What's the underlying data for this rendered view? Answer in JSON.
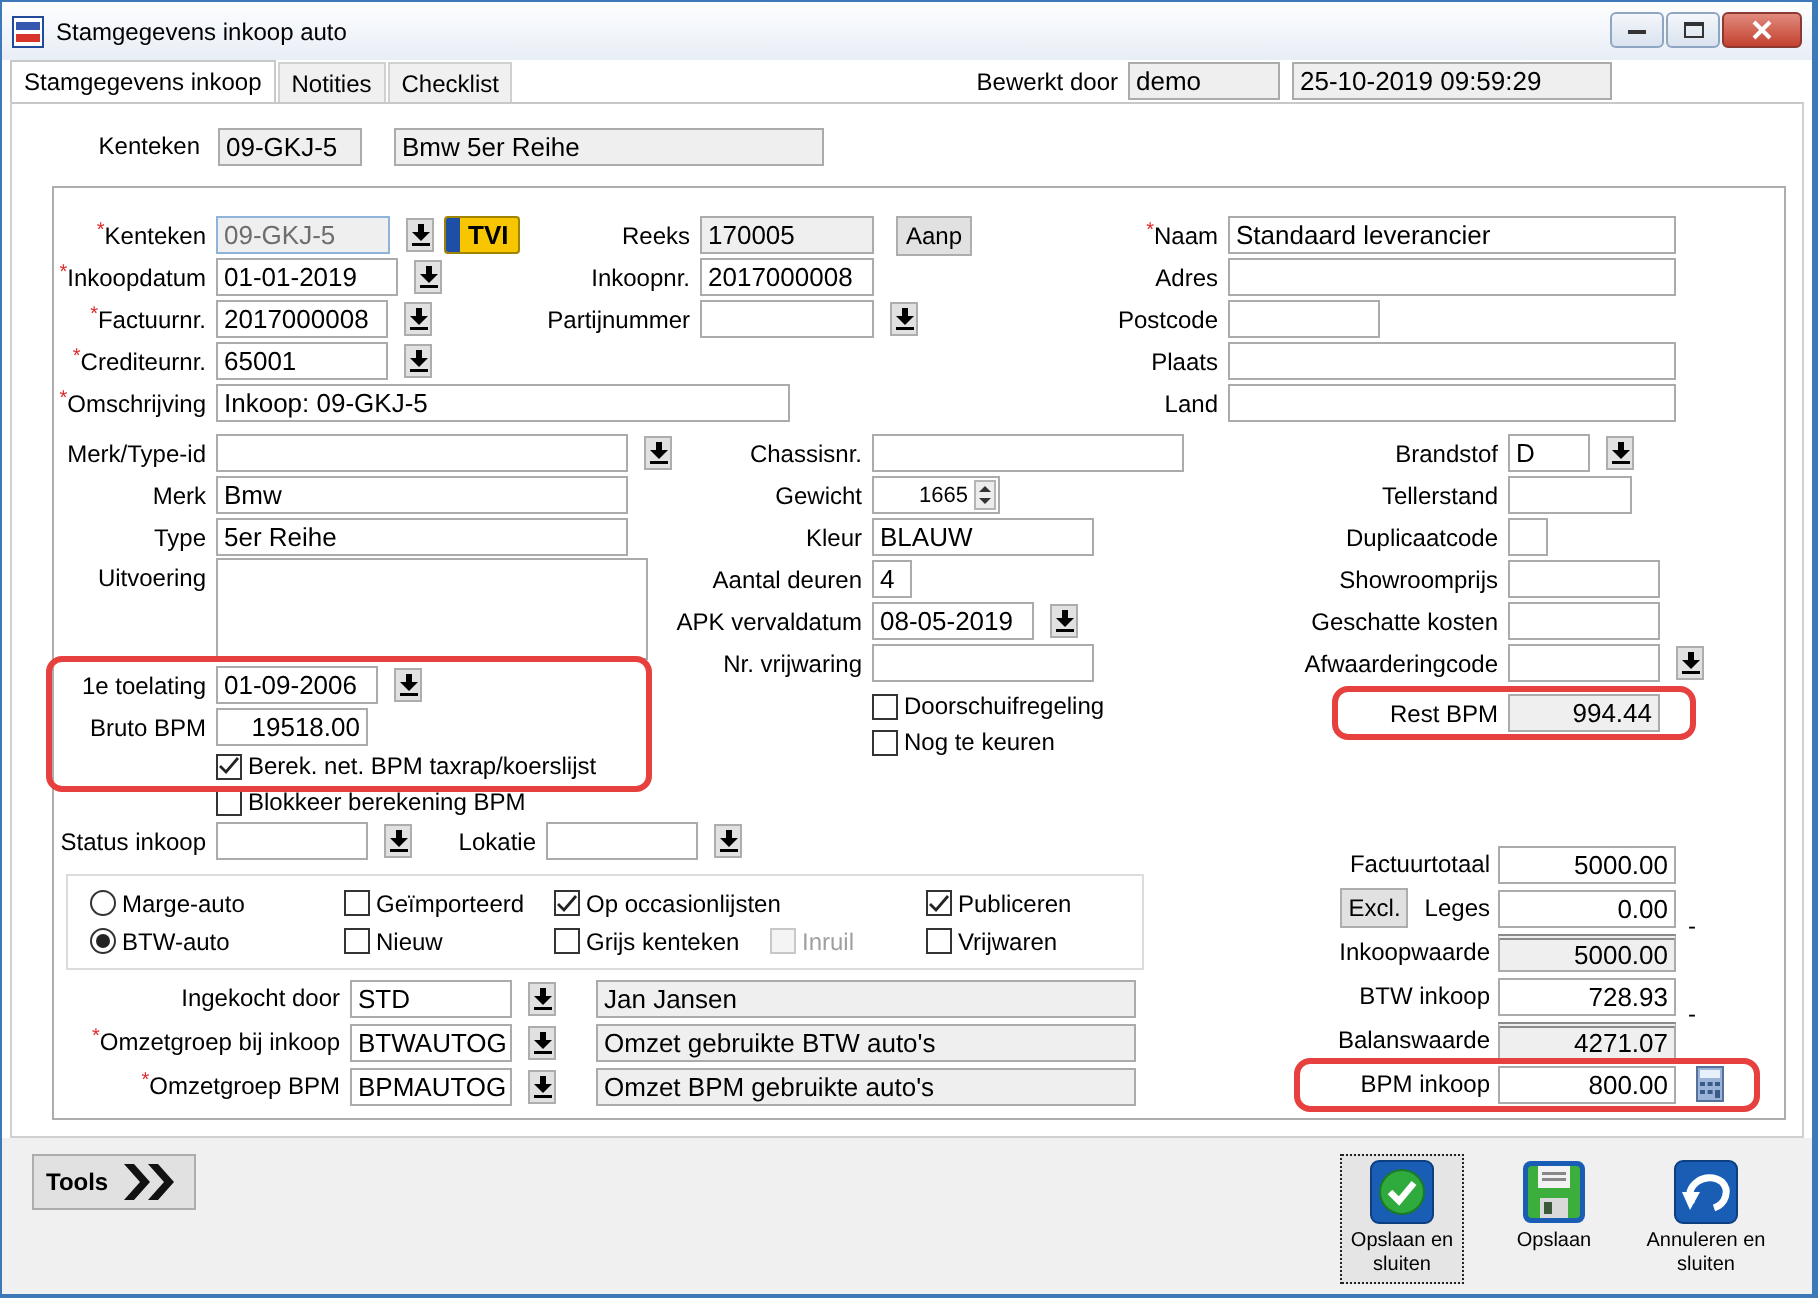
{
  "window": {
    "title": "Stamgegevens inkoop auto"
  },
  "tabs": [
    {
      "label": "Stamgegevens inkoop",
      "selected": true
    },
    {
      "label": "Notities",
      "selected": false
    },
    {
      "label": "Checklist",
      "selected": false
    }
  ],
  "edited_by": {
    "label": "Bewerkt door",
    "user": "demo",
    "timestamp": "25-10-2019 09:59:29"
  },
  "header": {
    "label": "Kenteken",
    "plate": "09-GKJ-5",
    "description": "Bmw 5er Reihe"
  },
  "purchase_fields": [
    {
      "mark": "*",
      "label": "Kenteken",
      "value": "09-GKJ-5",
      "readonly": true,
      "lookup": true,
      "badge": "TVI"
    },
    {
      "mark": "*",
      "label": "Inkoopdatum",
      "value": "01-01-2019",
      "readonly": false,
      "lookup": true
    },
    {
      "mark": "*",
      "label": "Factuurnr.",
      "value": "2017000008",
      "readonly": false,
      "lookup": true
    },
    {
      "mark": "*",
      "label": "Crediteurnr.",
      "value": "65001",
      "readonly": false,
      "lookup": true
    },
    {
      "mark": "*",
      "label": "Omschrijving",
      "value": "Inkoop: 09-GKJ-5",
      "readonly": false,
      "lookup": false
    }
  ],
  "series_fields": [
    {
      "label": "Reeks",
      "value": "170005",
      "readonly": true,
      "lookup": false,
      "button": "Aanp"
    },
    {
      "label": "Inkoopnr.",
      "value": "2017000008",
      "readonly": false,
      "lookup": false
    },
    {
      "label": "Partijnummer",
      "readonly": false,
      "lookup": true
    }
  ],
  "supplier_fields": [
    {
      "mark": "*",
      "label": "Naam",
      "value": "Standaard leverancier",
      "readonly": false,
      "lookup": false
    },
    {
      "label": "Adres",
      "readonly": false,
      "lookup": false
    },
    {
      "label": "Postcode",
      "readonly": false,
      "lookup": false
    },
    {
      "label": "Plaats",
      "readonly": false,
      "lookup": false
    },
    {
      "label": "Land",
      "readonly": false,
      "lookup": false
    }
  ],
  "vehicle_fields": [
    {
      "kind": "text",
      "label": "Merk/Type-id",
      "readonly": false,
      "lookup": true
    },
    {
      "kind": "text",
      "label": "Merk",
      "value": "Bmw",
      "readonly": false,
      "lookup": false
    },
    {
      "kind": "text",
      "label": "Type",
      "value": "5er Reihe",
      "readonly": false,
      "lookup": false
    },
    {
      "kind": "memo",
      "label": "Uitvoering",
      "readonly": false,
      "lookup": false
    }
  ],
  "bpm": {
    "highlighted": true,
    "fields": [
      {
        "label": "1e toelating",
        "value": "01-09-2006",
        "readonly": false,
        "lookup": true
      },
      {
        "label": "Bruto BPM",
        "value": "19518.00",
        "readonly": false,
        "lookup": false
      }
    ],
    "checks": [
      {
        "label": "Berek. net. BPM taxrap/koerslijst",
        "checked": true
      }
    ]
  },
  "block_bpm": {
    "label": "Blokkeer berekening BPM",
    "checked": false
  },
  "detail_fields": [
    {
      "kind": "text",
      "label": "Chassisnr.",
      "readonly": false,
      "lookup": false
    },
    {
      "kind": "spinner",
      "label": "Gewicht",
      "value": "1665",
      "readonly": false,
      "lookup": false
    },
    {
      "kind": "text",
      "label": "Kleur",
      "value": "BLAUW",
      "readonly": false,
      "lookup": false
    },
    {
      "kind": "text",
      "label": "Aantal deuren",
      "value": "4",
      "readonly": false,
      "lookup": false
    },
    {
      "kind": "text",
      "label": "APK vervaldatum",
      "value": "08-05-2019",
      "readonly": false,
      "lookup": true
    },
    {
      "kind": "text",
      "label": "Nr. vrijwaring",
      "readonly": false,
      "lookup": false
    }
  ],
  "detail_checks": [
    {
      "label": "Doorschuifregeling",
      "checked": false
    },
    {
      "label": "Nog te keuren",
      "checked": false
    }
  ],
  "extra_fields": [
    {
      "label": "Brandstof",
      "value": "D",
      "readonly": false,
      "lookup": true,
      "highlighted": false
    },
    {
      "label": "Tellerstand",
      "readonly": false,
      "lookup": false,
      "highlighted": false
    },
    {
      "label": "Duplicaatcode",
      "readonly": false,
      "lookup": false,
      "highlighted": false
    },
    {
      "label": "Showroomprijs",
      "readonly": false,
      "lookup": false,
      "highlighted": false
    },
    {
      "label": "Geschatte kosten",
      "readonly": false,
      "lookup": false,
      "highlighted": false
    },
    {
      "label": "Afwaarderingcode",
      "readonly": false,
      "lookup": true,
      "highlighted": false
    },
    {
      "label": "Rest BPM",
      "value": "994.44",
      "readonly": true,
      "lookup": false,
      "highlighted": true
    }
  ],
  "status_fields": [
    {
      "label": "Status inkoop",
      "readonly": false,
      "lookup": true
    },
    {
      "label": "Lokatie",
      "readonly": false,
      "lookup": true
    }
  ],
  "options": [
    [
      {
        "kind": "radio",
        "label": "Marge-auto",
        "selected": false,
        "disabled": false
      },
      {
        "kind": "checkbox",
        "label": "Geïmporteerd",
        "checked": false,
        "disabled": false
      },
      {
        "kind": "checkbox",
        "label": "Op occasionlijsten",
        "checked": true,
        "disabled": false
      },
      {
        "kind": "checkbox",
        "label": "Publiceren",
        "checked": true,
        "disabled": false
      }
    ],
    [
      {
        "kind": "radio",
        "label": "BTW-auto",
        "selected": true,
        "disabled": false
      },
      {
        "kind": "checkbox",
        "label": "Nieuw",
        "checked": false,
        "disabled": false
      },
      {
        "kind": "checkbox",
        "label": "Grijs kenteken",
        "checked": false,
        "disabled": false
      },
      {
        "kind": "checkbox",
        "label": "Inruil",
        "checked": false,
        "disabled": true
      },
      {
        "kind": "checkbox",
        "label": "Vrijwaren",
        "checked": false,
        "disabled": false
      }
    ]
  ],
  "purchase_groups": [
    {
      "label": "Ingekocht door",
      "value": "STD",
      "readonly": false,
      "lookup": true,
      "description": "Jan Jansen"
    },
    {
      "mark": "*",
      "label": "Omzetgroep bij inkoop",
      "value": "BTWAUTOG",
      "readonly": false,
      "lookup": true,
      "description": "Omzet gebruikte BTW auto's"
    },
    {
      "mark": "*",
      "label": "Omzetgroep BPM",
      "value": "BPMAUTOG",
      "readonly": false,
      "lookup": true,
      "description": "Omzet BPM gebruikte auto's"
    }
  ],
  "totals": [
    {
      "kind": "value",
      "label": "Factuurtotaal",
      "value": "5000.00",
      "readonly": false,
      "highlighted": false
    },
    {
      "kind": "value",
      "label": "Leges",
      "value": "0.00",
      "readonly": false,
      "highlighted": false,
      "button": "Excl.",
      "operator": "-"
    },
    {
      "kind": "value",
      "label": "Inkoopwaarde",
      "value": "5000.00",
      "readonly": true,
      "highlighted": false
    },
    {
      "kind": "value",
      "label": "BTW inkoop",
      "value": "728.93",
      "readonly": false,
      "highlighted": false,
      "operator": "-"
    },
    {
      "kind": "value",
      "label": "Balanswaarde",
      "value": "4271.07",
      "readonly": true,
      "highlighted": false
    },
    {
      "kind": "calc",
      "label": "BPM inkoop",
      "value": "800.00",
      "readonly": false,
      "highlighted": true
    }
  ],
  "footer": {
    "tools": "Tools",
    "actions": [
      {
        "kind": "save_close",
        "label": "Opslaan en sluiten",
        "focused": true
      },
      {
        "kind": "save",
        "label": "Opslaan",
        "focused": false
      },
      {
        "kind": "cancel",
        "label": "Annuleren en sluiten",
        "focused": false
      }
    ]
  }
}
